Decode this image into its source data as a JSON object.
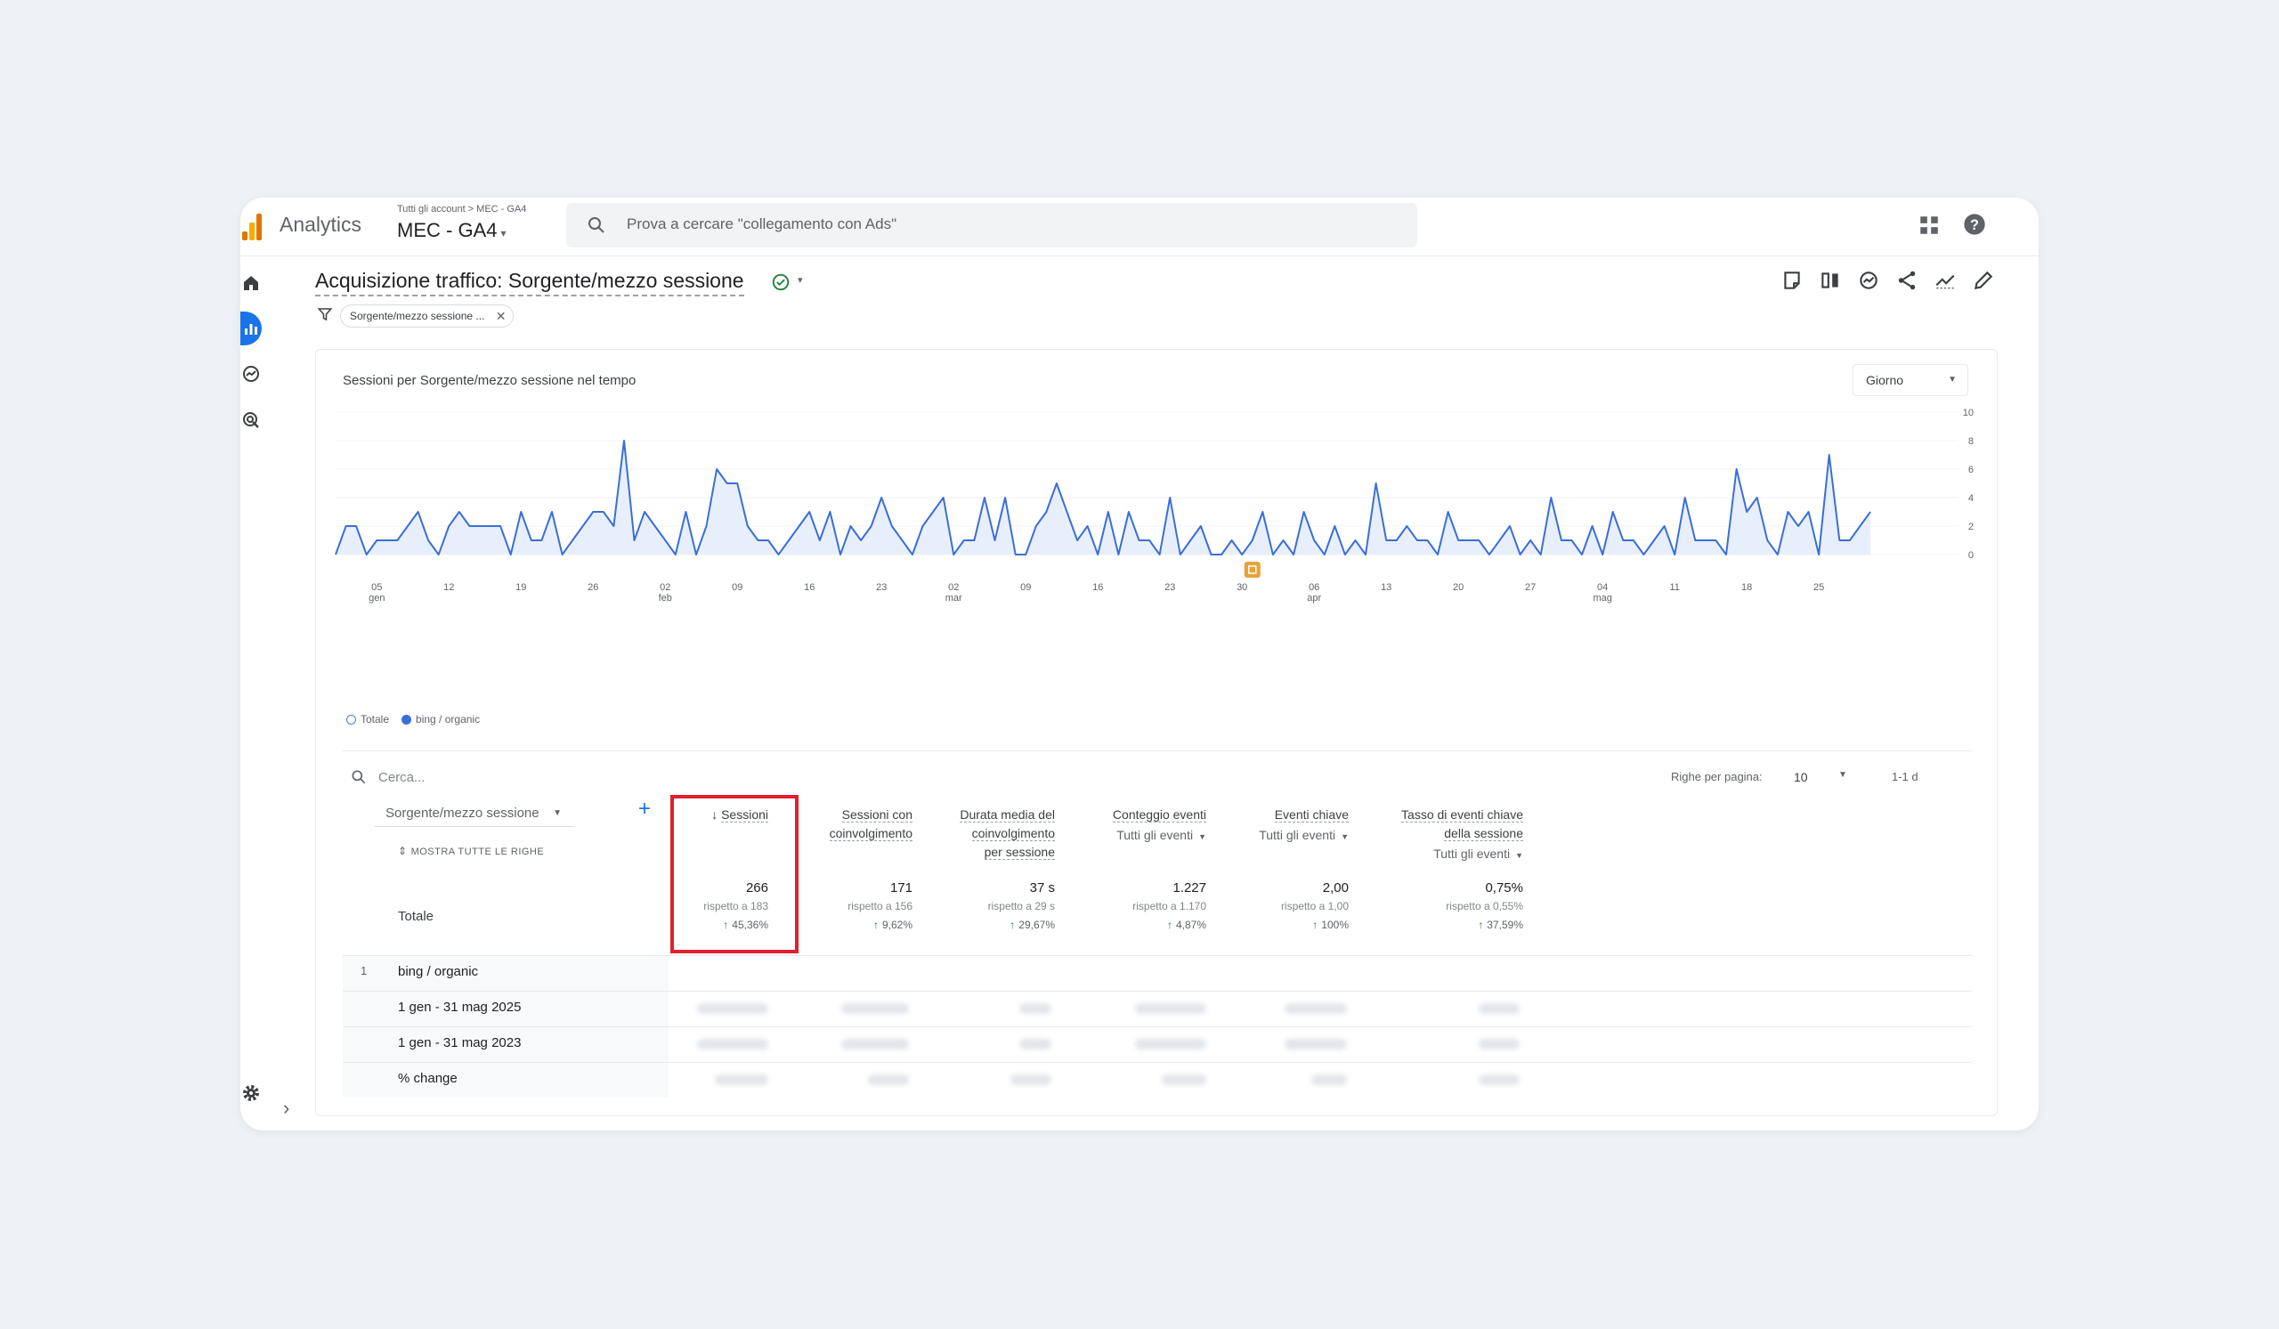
{
  "app": {
    "name": "Analytics",
    "account_breadcrumb": "Tutti gli account > MEC - GA4",
    "property": "MEC - GA4",
    "search_placeholder": "Prova a cercare \"collegamento con Ads\"",
    "icons": [
      "analytics-logo",
      "search-icon",
      "apps-grid-icon",
      "help-icon",
      "home-icon",
      "reports-icon",
      "explore-icon",
      "advertising-icon",
      "settings-icon"
    ]
  },
  "report": {
    "title": "Acquisizione traffico: Sorgente/mezzo sessione",
    "filter_chip": "Sorgente/mezzo sessione ...",
    "tool_icons": [
      "customize-report-icon",
      "compare-icon",
      "insights-icon",
      "share-icon",
      "trend-icon",
      "edit-icon"
    ]
  },
  "chart": {
    "title": "Sessioni per Sorgente/mezzo sessione nel tempo",
    "granularity": "Giorno",
    "legend": [
      {
        "label": "Totale",
        "style": "hollow"
      },
      {
        "label": "bing / organic",
        "style": "filled"
      }
    ]
  },
  "chart_data": {
    "type": "area",
    "title": "Sessioni per Sorgente/mezzo sessione nel tempo",
    "ylim": [
      0,
      10
    ],
    "y_ticks": [
      0,
      2,
      4,
      6,
      8,
      10
    ],
    "x_ticks": [
      {
        "day": "05",
        "month": "gen"
      },
      {
        "day": "12",
        "month": ""
      },
      {
        "day": "19",
        "month": ""
      },
      {
        "day": "26",
        "month": ""
      },
      {
        "day": "02",
        "month": "feb"
      },
      {
        "day": "09",
        "month": ""
      },
      {
        "day": "16",
        "month": ""
      },
      {
        "day": "23",
        "month": ""
      },
      {
        "day": "02",
        "month": "mar"
      },
      {
        "day": "09",
        "month": ""
      },
      {
        "day": "16",
        "month": ""
      },
      {
        "day": "23",
        "month": ""
      },
      {
        "day": "30",
        "month": ""
      },
      {
        "day": "06",
        "month": "apr"
      },
      {
        "day": "13",
        "month": ""
      },
      {
        "day": "20",
        "month": ""
      },
      {
        "day": "27",
        "month": ""
      },
      {
        "day": "04",
        "month": "mag"
      },
      {
        "day": "11",
        "month": ""
      },
      {
        "day": "18",
        "month": ""
      },
      {
        "day": "25",
        "month": ""
      }
    ],
    "x_start": "2025-01-01",
    "series": [
      {
        "name": "bing / organic",
        "color": "#3b6ed6",
        "values": [
          0,
          2,
          2,
          0,
          1,
          1,
          1,
          2,
          3,
          1,
          0,
          2,
          3,
          2,
          2,
          2,
          2,
          0,
          3,
          1,
          1,
          3,
          0,
          1,
          2,
          3,
          3,
          2,
          8,
          1,
          3,
          2,
          1,
          0,
          3,
          0,
          2,
          6,
          5,
          5,
          2,
          1,
          1,
          0,
          1,
          2,
          3,
          1,
          3,
          0,
          2,
          1,
          2,
          4,
          2,
          1,
          0,
          2,
          3,
          4,
          0,
          1,
          1,
          4,
          1,
          4,
          0,
          0,
          2,
          3,
          5,
          3,
          1,
          2,
          0,
          3,
          0,
          3,
          1,
          1,
          0,
          4,
          0,
          1,
          2,
          0,
          0,
          1,
          0,
          1,
          3,
          0,
          1,
          0,
          3,
          1,
          0,
          2,
          0,
          1,
          0,
          5,
          1,
          1,
          2,
          1,
          1,
          0,
          3,
          1,
          1,
          1,
          0,
          1,
          2,
          0,
          1,
          0,
          4,
          1,
          1,
          0,
          2,
          0,
          3,
          1,
          1,
          0,
          1,
          2,
          0,
          4,
          1,
          1,
          1,
          0,
          6,
          3,
          4,
          1,
          0,
          3,
          2,
          3,
          0,
          7,
          1,
          1,
          2,
          3
        ]
      }
    ],
    "annotation_marker": "30 mar"
  },
  "table": {
    "search_placeholder": "Cerca...",
    "rows_per_page_label": "Righe per pagina:",
    "rows_per_page": "10",
    "page_range": "1-1 d",
    "dimension": "Sorgente/mezzo sessione",
    "show_all_rows": "MOSTRA TUTTE LE RIGHE",
    "columns": [
      {
        "label": "Sessioni",
        "line2": "",
        "line3": "",
        "sub": "",
        "sorted": true
      },
      {
        "label": "Sessioni con",
        "line2": "coinvolgimento",
        "line3": "",
        "sub": ""
      },
      {
        "label": "Durata media del",
        "line2": "coinvolgimento",
        "line3": "per sessione",
        "sub": ""
      },
      {
        "label": "Conteggio eventi",
        "line2": "",
        "line3": "",
        "sub": "Tutti gli eventi"
      },
      {
        "label": "Eventi chiave",
        "line2": "",
        "line3": "",
        "sub": "Tutti gli eventi"
      },
      {
        "label": "Tasso di eventi chiave",
        "line2": "della sessione",
        "line3": "",
        "sub": "Tutti gli eventi"
      }
    ],
    "totals_label": "Totale",
    "totals": [
      {
        "value": "266",
        "compare": "rispetto a 183",
        "change": "45,36%"
      },
      {
        "value": "171",
        "compare": "rispetto a 156",
        "change": "9,62%"
      },
      {
        "value": "37 s",
        "compare": "rispetto a 29 s",
        "change": "29,67%"
      },
      {
        "value": "1.227",
        "compare": "rispetto a 1.170",
        "change": "4,87%"
      },
      {
        "value": "2,00",
        "compare": "rispetto a 1,00",
        "change": "100%"
      },
      {
        "value": "0,75%",
        "compare": "rispetto a 0,55%",
        "change": "37,59%"
      }
    ],
    "rows": [
      {
        "num": "1",
        "label": "bing / organic"
      },
      {
        "num": "",
        "label": "1 gen - 31 mag 2025"
      },
      {
        "num": "",
        "label": "1 gen - 31 mag 2023"
      },
      {
        "num": "",
        "label": "% change"
      }
    ],
    "highlight_color": "#e0202f"
  }
}
